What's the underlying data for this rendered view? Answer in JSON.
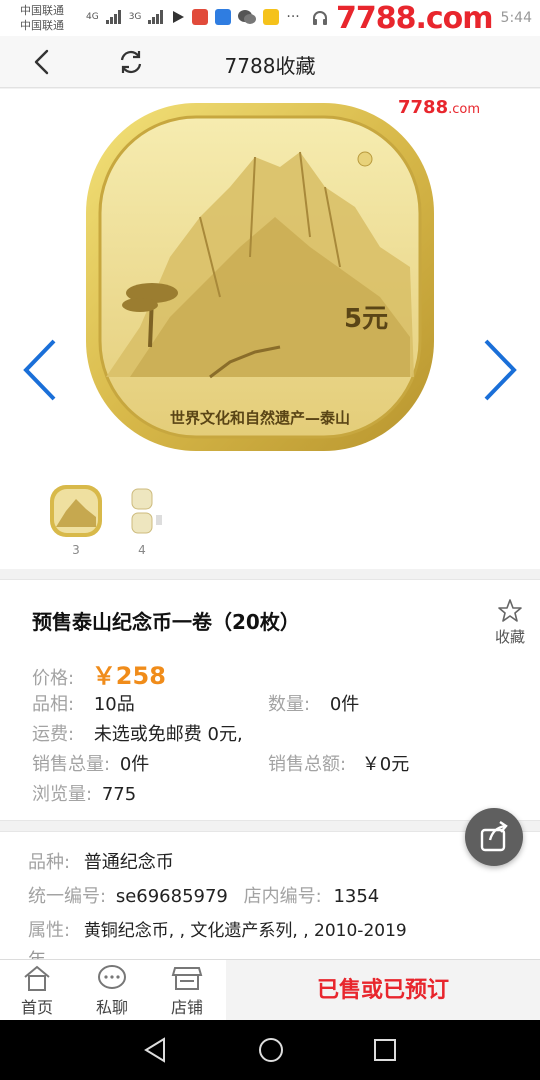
{
  "status_bar": {
    "carrier_1": "中国联通",
    "carrier_2": "中国联通",
    "network_1": "4G",
    "network_2": "3G",
    "watermark": "7788.com",
    "time": "5:44"
  },
  "nav": {
    "title": "7788收藏"
  },
  "gallery": {
    "watermark_main": "7788",
    "watermark_suffix": ".com",
    "coin_denomination": "5元",
    "coin_inscription": "世界文化和自然遗产—泰山",
    "thumbnails": [
      {
        "number": "3"
      },
      {
        "number": "4"
      }
    ]
  },
  "item": {
    "title": "预售泰山纪念币一卷（20枚）",
    "favorite_label": "收藏",
    "price_label": "价格:",
    "price_value": "￥258",
    "grade_label": "品相:",
    "grade_value": "10品",
    "quantity_label": "数量:",
    "quantity_value": "0件",
    "shipping_label": "运费:",
    "shipping_value": "未选或免邮费 0元,",
    "sold_count_label": "销售总量:",
    "sold_count_value": "0件",
    "sold_amount_label": "销售总额:",
    "sold_amount_value": "￥0元",
    "views_label": "浏览量:",
    "views_value": "775"
  },
  "spec": {
    "category_label": "品种:",
    "category_value": "普通纪念币",
    "uid_label": "统一编号:",
    "uid_value": "se69685979",
    "shop_no_label": "店内编号:",
    "shop_no_value": "1354",
    "attr_label": "属性:",
    "attr_value": "黄铜纪念币, , 文化遗产系列, , 2010-2019",
    "attr_value_cont": "年"
  },
  "bottom_bar": {
    "home_label": "首页",
    "chat_label": "私聊",
    "shop_label": "店铺",
    "action_label": "已售或已预订"
  },
  "colors": {
    "brand_red": "#e8262d",
    "price_orange": "#f08c1a",
    "arrow_blue": "#1a6fd8"
  },
  "icons": [
    "back-icon",
    "refresh-icon",
    "star-icon",
    "share-icon",
    "home-icon",
    "chat-icon",
    "shop-icon",
    "nav-back-triangle-icon",
    "nav-home-circle-icon",
    "nav-recents-square-icon"
  ]
}
